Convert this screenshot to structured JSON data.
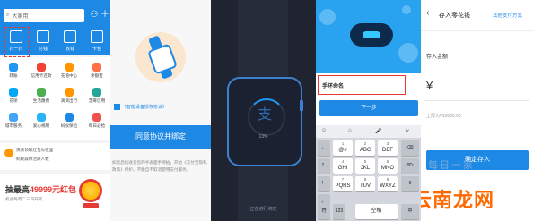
{
  "panel1": {
    "search_placeholder": "大家用",
    "quick": [
      "扫一扫",
      "付钱",
      "收钱",
      "卡包"
    ],
    "grid": [
      {
        "label": "转账",
        "color": "#2196f3"
      },
      {
        "label": "信用卡还款",
        "color": "#f44336"
      },
      {
        "label": "充值中心",
        "color": "#ff9800"
      },
      {
        "label": "余额宝",
        "color": "#ff7043"
      },
      {
        "label": "花呗",
        "color": "#03a9f4"
      },
      {
        "label": "生活缴费",
        "color": "#4caf50"
      },
      {
        "label": "滴滴出行",
        "color": "#ff9800"
      },
      {
        "label": "芝麻信用",
        "color": "#26a69a"
      },
      {
        "label": "城市服务",
        "color": "#42a5f5"
      },
      {
        "label": "爱心捐赠",
        "color": "#29b6f6"
      },
      {
        "label": "蚂蚁保险",
        "color": "#1e88e5"
      },
      {
        "label": "每日必抢",
        "color": "#ef5350"
      },
      {
        "label": "更多",
        "color": "#1e88e5"
      }
    ],
    "news": [
      "快去领取红包你这里",
      "蚂蚁森林活跃人数"
    ],
    "promo_prefix": "抽最高",
    "promo_amount": "49999元红包",
    "promo_sub": "机会每周二三四开奖"
  },
  "panel2": {
    "agree_link": "《智能设备授权协议》",
    "agree_btn": "同意协议并绑定",
    "fine_print": "如您后续收货您的手表面手绑拍，开始《支付宝隐私政策》保护，不能自不取消使用支付服务。"
  },
  "panel3": {
    "progress_text": "13%",
    "bottom_text": "正在进行绑定"
  },
  "panel4": {
    "name_value": "手环命名",
    "next_btn": "下一步",
    "kb_bar": [
      "☺",
      "⌂",
      "🎤",
      "∨"
    ],
    "keys": [
      {
        "n": "1",
        "l": "@#"
      },
      {
        "n": "2",
        "l": "ABC"
      },
      {
        "n": "3",
        "l": "DEF"
      },
      {
        "n": "4",
        "l": "GHI"
      },
      {
        "n": "5",
        "l": "JKL"
      },
      {
        "n": "6",
        "l": "MNO"
      },
      {
        "n": "7",
        "l": "PQRS"
      },
      {
        "n": "8",
        "l": "TUV"
      },
      {
        "n": "9",
        "l": "WXYZ"
      }
    ],
    "side_keys": [
      "，",
      "？",
      "！",
      "。",
      "符",
      "123"
    ],
    "bottom_keys": [
      "中",
      "完成"
    ],
    "space": "空格"
  },
  "panel5": {
    "title": "存入零花钱",
    "other_pay": "其他支付方式",
    "amount_label": "存入金额",
    "yen": "¥",
    "limit": "上限为¥10000.00",
    "confirm": "确定存入",
    "watermark": "云南龙网",
    "watermark_bg": "每日一家"
  }
}
